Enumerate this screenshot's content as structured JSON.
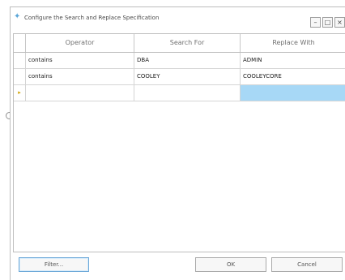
{
  "window": {
    "title": "Configure the Search and Replace Specification",
    "controls": [
      "–",
      "□",
      "×"
    ]
  },
  "grid": {
    "columns": [
      "Operator",
      "Search For",
      "Replace With"
    ],
    "rows": [
      [
        "contains",
        "DBA",
        "ADMIN"
      ],
      [
        "contains",
        "COOLEY",
        "COOLEYCORE"
      ],
      [
        "",
        "",
        ""
      ]
    ],
    "new_row_marker": "▸"
  },
  "buttons": {
    "filter": "Filter...",
    "ok": "OK",
    "cancel": "Cancel"
  },
  "icons": {
    "app": "app-icon",
    "new_row": "new-row-marker-icon",
    "left_marker": "resize-grip-icon"
  },
  "colors": {
    "selected_cell": "#a7d8f6",
    "accent": "#6ba8d8"
  }
}
